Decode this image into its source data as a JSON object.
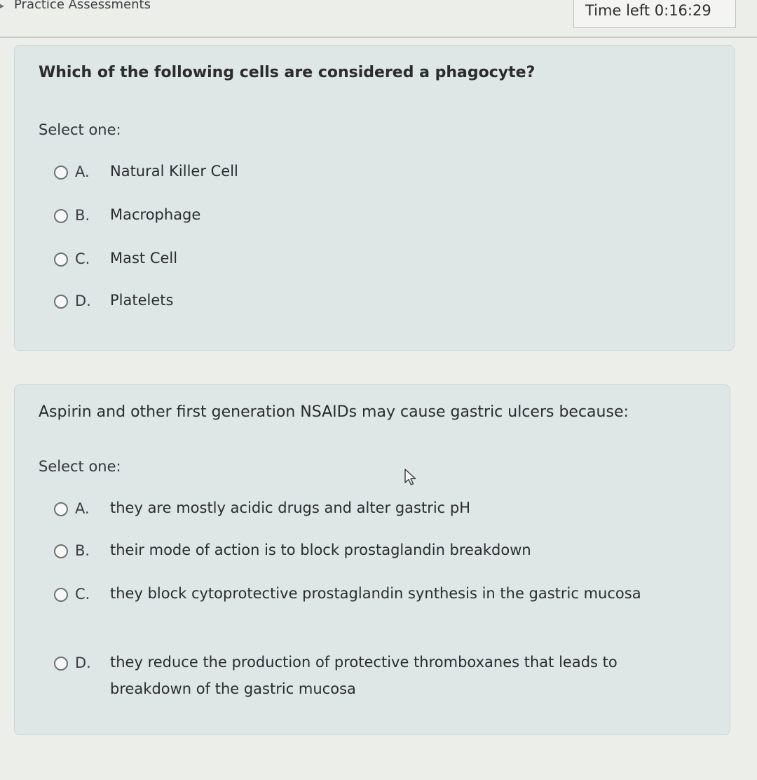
{
  "header": {
    "breadcrumb": "Practice Assessments",
    "timer_label": "Time left 0:16:29"
  },
  "questions": [
    {
      "prompt": "Which of the following cells are considered a phagocyte?",
      "select_label": "Select one:",
      "options": [
        {
          "letter": "A.",
          "text": "Natural Killer Cell"
        },
        {
          "letter": "B.",
          "text": "Macrophage"
        },
        {
          "letter": "C.",
          "text": "Mast Cell"
        },
        {
          "letter": "D.",
          "text": "Platelets"
        }
      ]
    },
    {
      "prompt": "Aspirin and other first generation NSAIDs may cause gastric ulcers because:",
      "select_label": "Select one:",
      "options": [
        {
          "letter": "A.",
          "text": "they are mostly acidic drugs and alter gastric pH"
        },
        {
          "letter": "B.",
          "text": "their mode of action is to block prostaglandin breakdown"
        },
        {
          "letter": "C.",
          "text": "they block cytoprotective prostaglandin synthesis in the gastric mucosa"
        },
        {
          "letter": "D.",
          "text": "they reduce the production of protective thromboxanes that leads to breakdown of the gastric mucosa"
        }
      ]
    }
  ],
  "colors": {
    "page_background": "#eceeea",
    "card_background": "#dfe6e6",
    "radio_border": "#6e7276"
  },
  "icons": {
    "breadcrumb_chevron": "chevron-right-icon",
    "mouse_pointer": "mouse-pointer-icon"
  }
}
